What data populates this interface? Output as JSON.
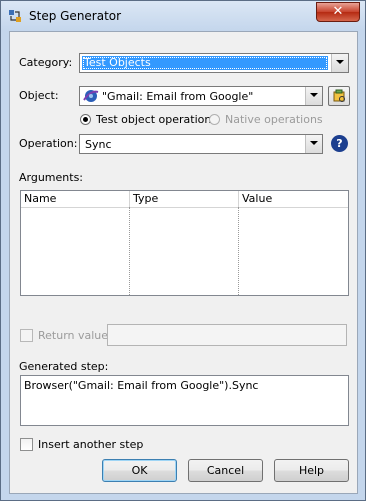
{
  "window": {
    "title": "Step Generator",
    "close_glyph": "✕"
  },
  "category": {
    "label": "Category:",
    "value": "Test Objects"
  },
  "object": {
    "label": "Object:",
    "value": "\"Gmail: Email from Google\""
  },
  "operation_type": {
    "test_label": "Test object operations",
    "native_label": "Native operations",
    "selected": "test"
  },
  "operation": {
    "label": "Operation:",
    "value": "Sync",
    "help_glyph": "?"
  },
  "arguments": {
    "label": "Arguments:",
    "columns": [
      "Name",
      "Type",
      "Value"
    ]
  },
  "return_value": {
    "label": "Return value",
    "checked": false,
    "enabled": false,
    "value": ""
  },
  "generated_step": {
    "label": "Generated step:",
    "value": "Browser(\"Gmail: Email from Google\").Sync"
  },
  "insert_another": {
    "label": "Insert another step",
    "checked": false
  },
  "buttons": {
    "ok": "OK",
    "cancel": "Cancel",
    "help": "Help"
  },
  "colors": {
    "selection": "#3399ff",
    "frame": "#c4d6ec",
    "close": "#c7422c"
  }
}
